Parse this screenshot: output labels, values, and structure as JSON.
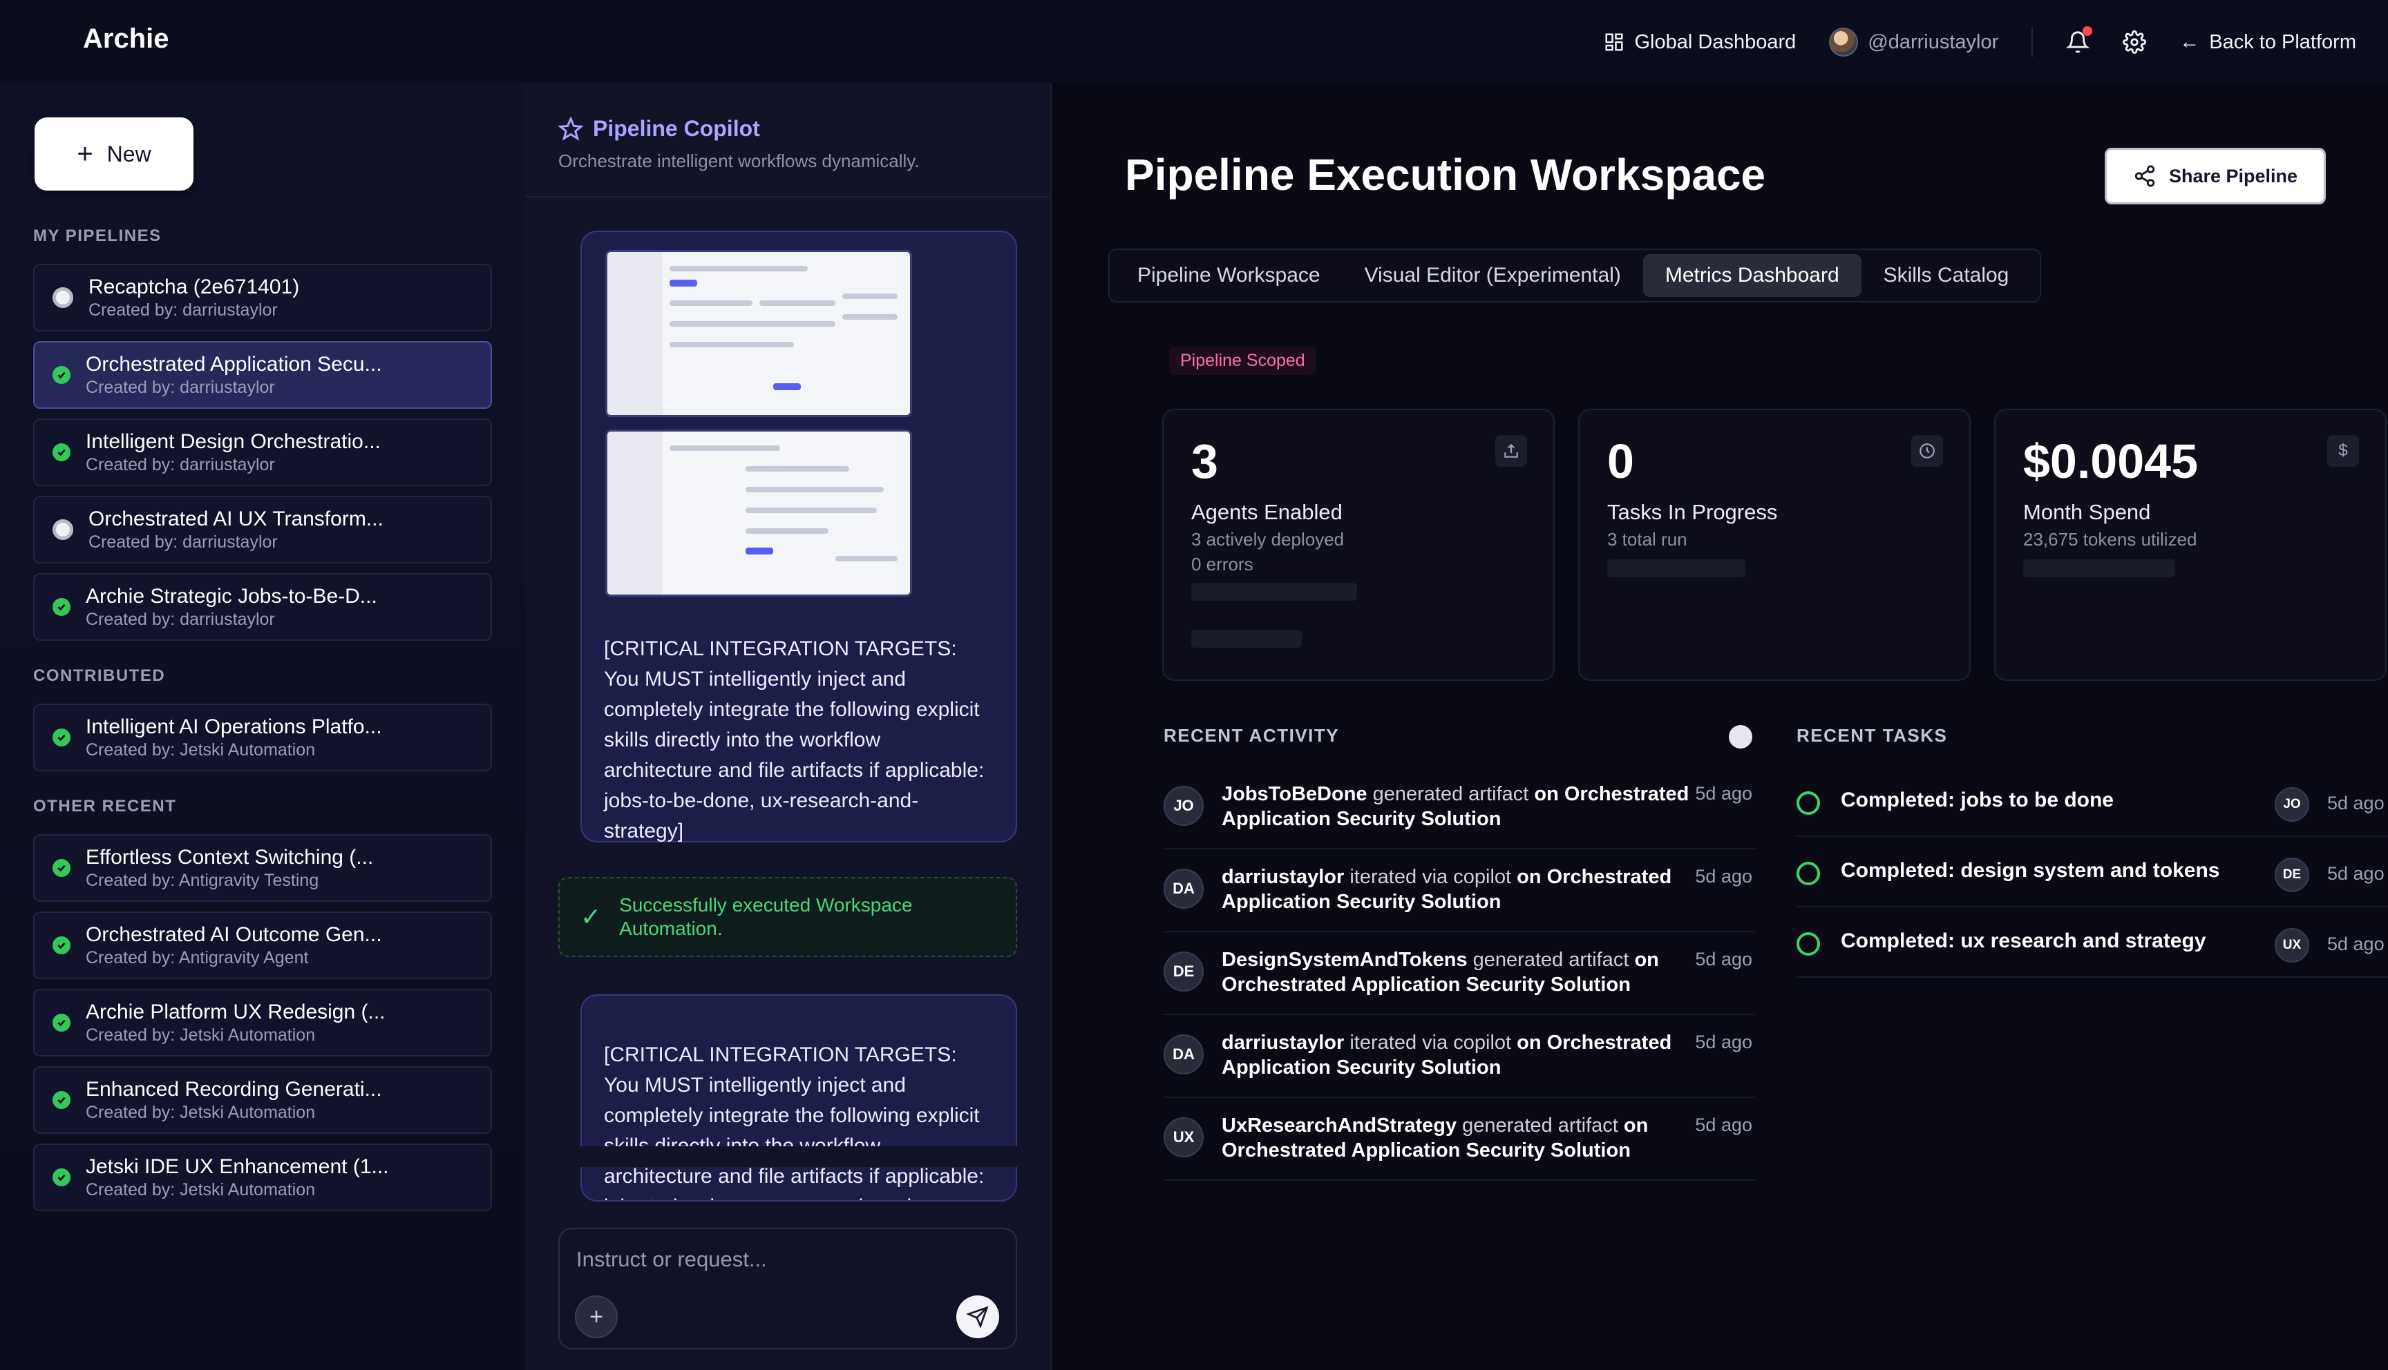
{
  "app": {
    "brand": "Archie"
  },
  "topnav": {
    "global_dashboard": "Global Dashboard",
    "user": "@darriustaylor",
    "back": "Back to Platform"
  },
  "sidebar": {
    "new_label": "New",
    "sections": {
      "my": "MY PIPELINES",
      "contributed": "CONTRIBUTED",
      "other": "OTHER RECENT"
    },
    "my_pipelines": [
      {
        "title": "Recaptcha (2e671401)",
        "sub": "Created by: darriustaylor",
        "status": "pending"
      },
      {
        "title": "Orchestrated Application Secu...",
        "sub": "Created by: darriustaylor",
        "status": "done"
      },
      {
        "title": "Intelligent Design Orchestratio...",
        "sub": "Created by: darriustaylor",
        "status": "done"
      },
      {
        "title": "Orchestrated AI UX Transform...",
        "sub": "Created by: darriustaylor",
        "status": "pending"
      },
      {
        "title": "Archie Strategic Jobs-to-Be-D...",
        "sub": "Created by: darriustaylor",
        "status": "done"
      }
    ],
    "contributed": [
      {
        "title": "Intelligent AI Operations Platfo...",
        "sub": "Created by: Jetski Automation",
        "status": "done"
      }
    ],
    "other_recent": [
      {
        "title": "Effortless Context Switching (...",
        "sub": "Created by: Antigravity Testing",
        "status": "done"
      },
      {
        "title": "Orchestrated AI Outcome Gen...",
        "sub": "Created by: Antigravity Agent",
        "status": "done"
      },
      {
        "title": "Archie Platform UX Redesign (...",
        "sub": "Created by: Jetski Automation",
        "status": "done"
      },
      {
        "title": "Enhanced Recording Generati...",
        "sub": "Created by: Jetski Automation",
        "status": "done"
      },
      {
        "title": "Jetski IDE UX Enhancement (1...",
        "sub": "Created by: Jetski Automation",
        "status": "done"
      }
    ]
  },
  "copilot": {
    "title": "Pipeline Copilot",
    "subtitle": "Orchestrate intelligent workflows dynamically.",
    "message_1": "[CRITICAL INTEGRATION TARGETS: You MUST intelligently inject and completely integrate the following explicit skills directly into the workflow architecture and file artifacts if applicable: jobs-to-be-done, ux-research-and-strategy]",
    "success": "Successfully executed Workspace Automation.",
    "message_2": "[CRITICAL INTEGRATION TARGETS: You MUST intelligently inject and completely integrate the following explicit skills directly into the workflow architecture and file artifacts if applicable: jobs-to-be-done, ux-research-and-strategy]",
    "input_placeholder": "Instruct or request..."
  },
  "main": {
    "title": "Pipeline Execution Workspace",
    "share": "Share Pipeline",
    "tabs": [
      "Pipeline Workspace",
      "Visual Editor (Experimental)",
      "Metrics Dashboard",
      "Skills Catalog"
    ],
    "active_tab": "Metrics Dashboard",
    "scope": "Pipeline Scoped",
    "metrics": [
      {
        "value": "3",
        "label": "Agents Enabled",
        "sub1": "3 actively deployed",
        "sub2": "0 errors",
        "icon": "upload-icon"
      },
      {
        "value": "0",
        "label": "Tasks In Progress",
        "sub1": "3 total run",
        "sub2": "",
        "icon": "clock-icon"
      },
      {
        "value": "$0.0045",
        "label": "Month Spend",
        "sub1": "23,675 tokens utilized",
        "sub2": "",
        "icon": "dollar-icon"
      }
    ],
    "recent_activity_title": "RECENT ACTIVITY",
    "activity": [
      {
        "initials": "JO",
        "actor": "JobsToBeDone",
        "action": "generated artifact",
        "target_prefix": "on",
        "target": "Orchestrated Application Security Solution",
        "time": "5d ago"
      },
      {
        "initials": "DA",
        "actor": "darriustaylor",
        "action": "iterated via copilot",
        "target_prefix": "on",
        "target": "Orchestrated Application Security Solution",
        "time": "5d ago"
      },
      {
        "initials": "DE",
        "actor": "DesignSystemAndTokens",
        "action": "generated artifact",
        "target_prefix": "on",
        "target": "Orchestrated Application Security Solution",
        "time": "5d ago"
      },
      {
        "initials": "DA",
        "actor": "darriustaylor",
        "action": "iterated via copilot",
        "target_prefix": "on",
        "target": "Orchestrated Application Security Solution",
        "time": "5d ago"
      },
      {
        "initials": "UX",
        "actor": "UxResearchAndStrategy",
        "action": "generated artifact",
        "target_prefix": "on",
        "target": "Orchestrated Application Security Solution",
        "time": "5d ago"
      }
    ],
    "recent_tasks_title": "RECENT TASKS",
    "tasks": [
      {
        "title": "Completed: jobs to be done",
        "initials": "JO",
        "time": "5d ago"
      },
      {
        "title": "Completed: design system and tokens",
        "initials": "DE",
        "time": "5d ago"
      },
      {
        "title": "Completed: ux research and strategy",
        "initials": "UX",
        "time": "5d ago"
      }
    ]
  },
  "colors": {
    "accent": "#a9a6ff",
    "success": "#34c759",
    "scope": "#ff6fa7",
    "background": "#0c0d1c"
  }
}
